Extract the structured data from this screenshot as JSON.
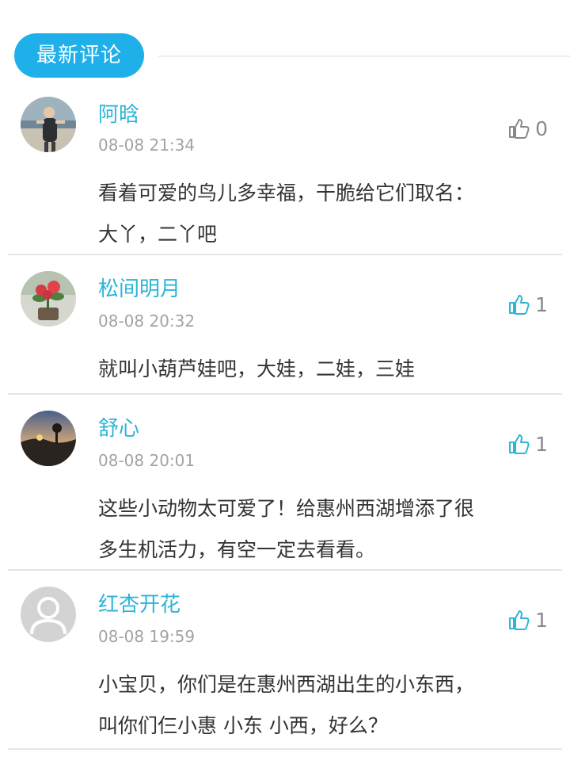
{
  "header": {
    "title": "最新评论"
  },
  "comments": [
    {
      "username": "阿晗",
      "time": "08-08 21:34",
      "likes": "0",
      "liked": false,
      "avatar_icon": "person-photo-avatar",
      "lines": [
        "看着可爱的鸟儿多幸福，干脆给它们取名：",
        "大丫，二丫吧"
      ]
    },
    {
      "username": "松间明月",
      "time": "08-08 20:32",
      "likes": "1",
      "liked": true,
      "avatar_icon": "flower-photo-avatar",
      "lines": [
        "就叫小葫芦娃吧，大娃，二娃，三娃"
      ]
    },
    {
      "username": "舒心",
      "time": "08-08 20:01",
      "likes": "1",
      "liked": true,
      "avatar_icon": "sunset-photo-avatar",
      "lines": [
        "这些小动物太可爱了！给惠州西湖增添了很",
        "多生机活力，有空一定去看看。"
      ]
    },
    {
      "username": "红杏开花",
      "time": "08-08 19:59",
      "likes": "1",
      "liked": true,
      "avatar_icon": "default-user-avatar",
      "lines": [
        "小宝贝，你们是在惠州西湖出生的小东西，",
        "叫你们仨小惠 小东 小西，好么？"
      ]
    }
  ],
  "colors": {
    "accent": "#1fb0ea",
    "username": "#2bb5d8",
    "like_active": "#2bb5d8",
    "like_inactive": "#888888"
  }
}
